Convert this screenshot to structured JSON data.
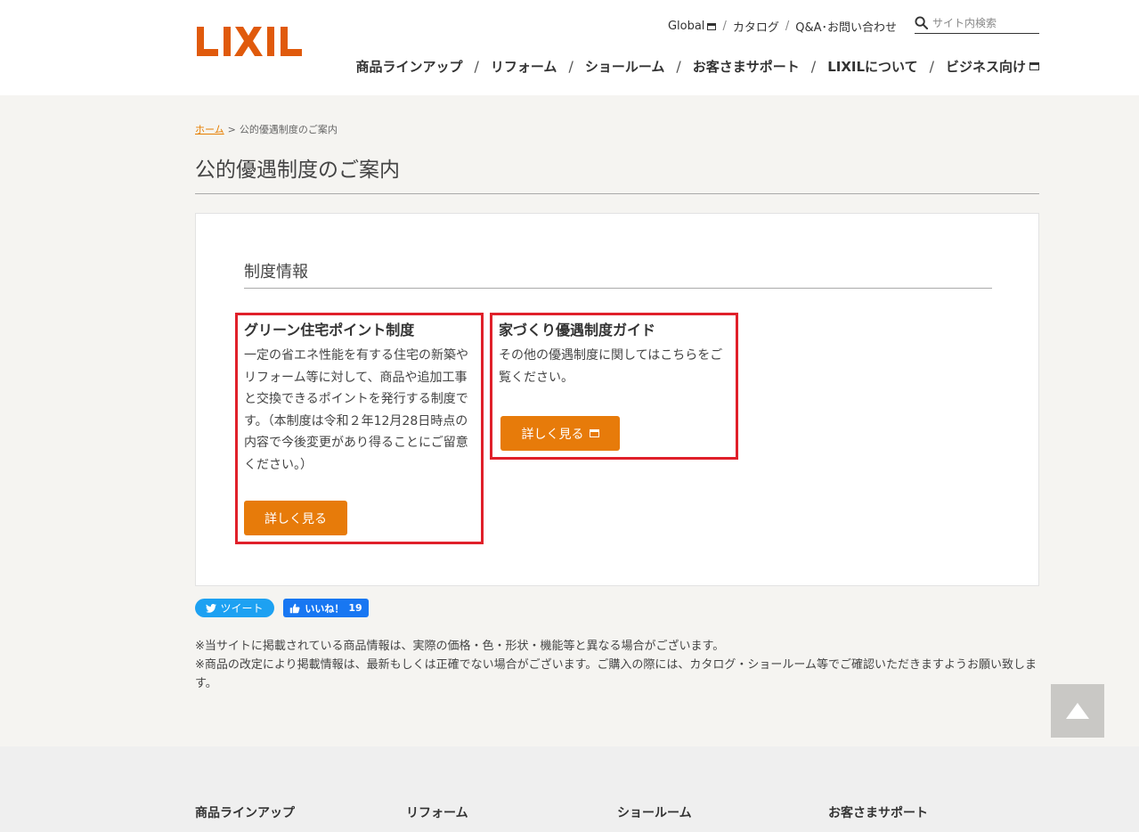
{
  "header": {
    "logo_text": "LIXIL",
    "brand_color": "#e05a0c",
    "util_links": [
      {
        "label": "Global",
        "new_window": true
      },
      {
        "label": "カタログ"
      },
      {
        "label": "Q&A･お問い合わせ"
      }
    ],
    "search_placeholder": "サイト内検索",
    "nav": [
      {
        "label": "商品ラインアップ"
      },
      {
        "label": "リフォーム"
      },
      {
        "label": "ショールーム"
      },
      {
        "label": "お客さまサポート"
      },
      {
        "label": "LIXILについて"
      },
      {
        "label": "ビジネス向け",
        "new_window": true
      }
    ]
  },
  "breadcrumb": {
    "home": "ホーム",
    "separator": ">",
    "current": "公的優遇制度のご案内"
  },
  "page_title": "公的優遇制度のご案内",
  "section": {
    "title": "制度情報",
    "cards": [
      {
        "heading": "グリーン住宅ポイント制度",
        "body": "一定の省エネ性能を有する住宅の新築やリフォーム等に対して、商品や追加工事と交換できるポイントを発行する制度です。（本制度は令和２年12月28日時点の内容で今後変更があり得ることにご留意ください。）",
        "button": "詳しく見る"
      },
      {
        "heading": "家づくり優遇制度ガイド",
        "body": "その他の優遇制度に関してはこちらをご覧ください。",
        "button": "詳しく見る"
      }
    ]
  },
  "social": {
    "tweet": "ツイート",
    "like": "いいね！",
    "like_count": "19"
  },
  "notes": [
    "※当サイトに掲載されている商品情報は、実際の価格・色・形状・機能等と異なる場合がございます。",
    "※商品の改定により掲載情報は、最新もしくは正確でない場合がございます。ご購入の際には、カタログ・ショールーム等でご確認いただきますようお願い致します。"
  ],
  "footer_nav": [
    "商品ラインアップ",
    "リフォーム",
    "ショールーム",
    "お客さまサポート"
  ],
  "colors": {
    "accent": "#e77b0a",
    "highlight_border": "#e0202a",
    "tweet": "#1da1f2",
    "like": "#1877f2"
  }
}
